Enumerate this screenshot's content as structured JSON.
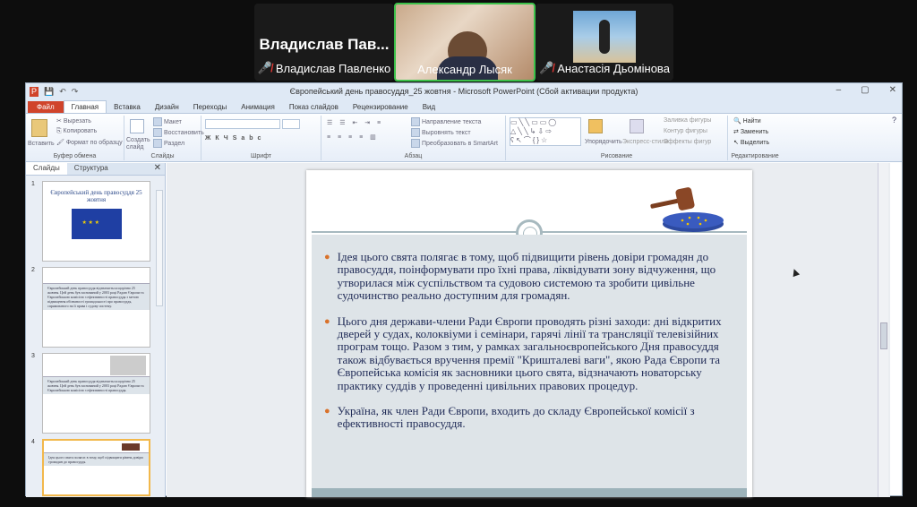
{
  "participants": {
    "tile1": {
      "display": "Владислав  Пав...",
      "name": "Владислав Павленко",
      "muted": true
    },
    "tile2": {
      "name": "Александр Лысяк",
      "muted": false
    },
    "tile3": {
      "name": "Анастасія Дьомінова",
      "muted": true
    }
  },
  "window": {
    "title": "Європейський день правосуддя_25 жовтня - Microsoft PowerPoint (Сбой активации продукта)",
    "controls": [
      "–",
      "▢",
      "✕"
    ]
  },
  "ribbon_tabs": [
    "Файл",
    "Главная",
    "Вставка",
    "Дизайн",
    "Переходы",
    "Анимация",
    "Показ слайдов",
    "Рецензирование",
    "Вид"
  ],
  "ribbon": {
    "clipboard": {
      "paste": "Вставить",
      "cut": "Вырезать",
      "copy": "Копировать",
      "format": "Формат по образцу",
      "label": "Буфер обмена"
    },
    "slides": {
      "new": "Создать слайд",
      "layout": "Макет",
      "reset": "Восстановить",
      "section": "Раздел",
      "label": "Слайды"
    },
    "font": {
      "label": "Шрифт"
    },
    "paragraph": {
      "direction": "Направление текста",
      "align": "Выровнять текст",
      "smartart": "Преобразовать в SmartArt",
      "label": "Абзац"
    },
    "drawing": {
      "arrange": "Упорядочить",
      "quick": "Экспресс-стили",
      "fill": "Заливка фигуры",
      "outline": "Контур фигуры",
      "effects": "Эффекты фигур",
      "label": "Рисование"
    },
    "editing": {
      "find": "Найти",
      "replace": "Заменить",
      "select": "Выделить",
      "label": "Редактирование"
    }
  },
  "left_pane": {
    "tabs": [
      "Слайды",
      "Структура"
    ],
    "thumbs": [
      {
        "num": "1",
        "title": "Європейський день правосуддя 25 жовтня"
      },
      {
        "num": "2",
        "text": "Європейський день правосуддя відзначається щорічно 25 жовтня. Цей день був заснований у 2003 році Радою Європи та Європейською комісією з ефективності правосуддя з метою підвищення обізнаності громадськості про правосуддя, спрямованого на її права і судову систему."
      },
      {
        "num": "3",
        "text": "Європейський день правосуддя відзначається щорічно 25 жовтня. Цей день був заснований у 2003 році Радою Європи та Європейською комісією з ефективності правосуддя."
      },
      {
        "num": "4",
        "text": "Ідея цього свята полягає в тому, щоб підвищити рівень довіри громадян до правосуддя."
      }
    ]
  },
  "slide": {
    "bullets": [
      "Ідея цього свята полягає в тому, щоб підвищити рівень довіри громадян до правосуддя, поінформувати про їхні права, ліквідувати зону відчуження, що утворилася між суспільством та судовою системою та зробити цивільне судочинство реально доступним для громадян.",
      "Цього дня держави-члени Ради Європи проводять різні заходи: дні відкритих дверей у судах, колоквіуми і семінари, гарячі лінії та трансляції телевізійних програм тощо. Разом з тим, у рамках загальноєвропейського Дня правосуддя також відбувається вручення премії \"Кришталеві ваги\", якою Рада Європи та Європейська комісія як засновники цього свята, відзначають новаторську практику суддів у проведенні цивільних правових процедур.",
      "Україна, як член Ради Європи, входить до складу Європейської комісії з ефективності правосуддя."
    ]
  },
  "colors": {
    "accent": "#d0442b",
    "slide_bg": "#dee4e8",
    "text": "#1f2a56",
    "bullet": "#d9722b"
  }
}
